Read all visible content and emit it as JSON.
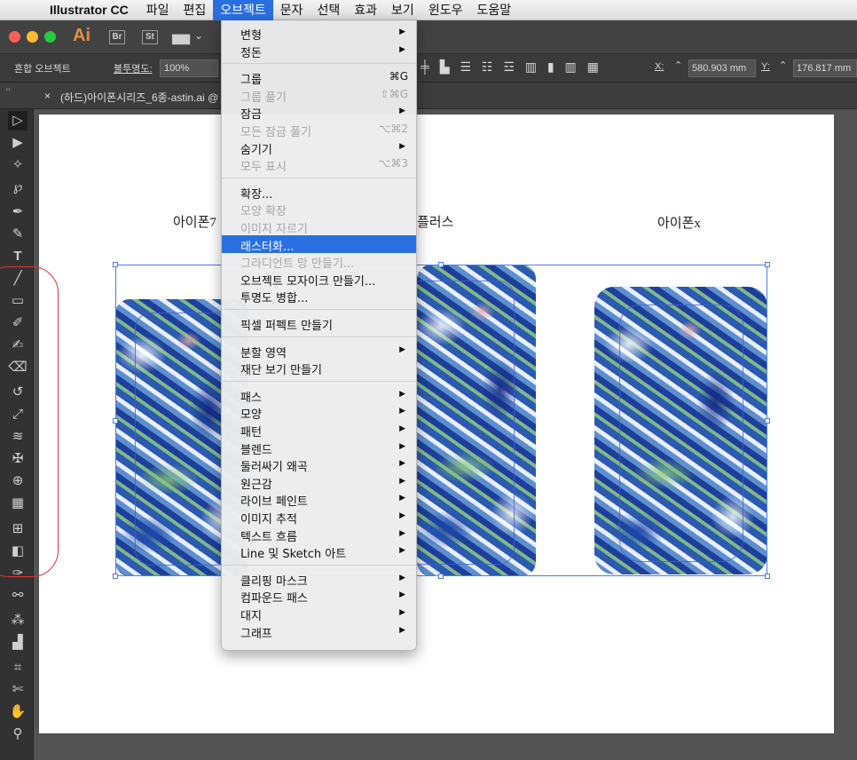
{
  "menubar": {
    "app": "Illustrator CC",
    "items": [
      "파일",
      "편집",
      "오브젝트",
      "문자",
      "선택",
      "효과",
      "보기",
      "윈도우",
      "도움말"
    ],
    "active_index": 2
  },
  "appbar": {
    "logo": "Ai",
    "br": "Br",
    "st": "St"
  },
  "controlbar": {
    "object_type": "혼합 오브젝트",
    "opacity_label": "불투명도:",
    "opacity_value": "100%",
    "x_label": "X:",
    "x_value": "580.903 mm",
    "y_label": "Y:",
    "y_value": "176.817 mm"
  },
  "document_tab": {
    "title": "(하드)아이폰시리즈_6종-astin.ai @"
  },
  "labels": {
    "a": "아이폰7",
    "b": "플러스",
    "c": "아이폰x"
  },
  "menu": {
    "groups": [
      [
        {
          "t": "변형",
          "a": true
        },
        {
          "t": "정돈",
          "a": true
        }
      ],
      [
        {
          "t": "그룹",
          "k": "⌘G"
        },
        {
          "t": "그룹 풀기",
          "k": "⇧⌘G",
          "dis": true
        },
        {
          "t": "잠금",
          "a": true
        },
        {
          "t": "모든 잠금 풀기",
          "k": "⌥⌘2",
          "dis": true
        },
        {
          "t": "숨기기",
          "a": true
        },
        {
          "t": "모두 표시",
          "k": "⌥⌘3",
          "dis": true
        }
      ],
      [
        {
          "t": "확장..."
        },
        {
          "t": "모양 확장",
          "dis": true
        },
        {
          "t": "이미지 자르기",
          "dis": true
        },
        {
          "t": "래스터화...",
          "hi": true
        },
        {
          "t": "그라디언트 망 만들기...",
          "dis": true
        },
        {
          "t": "오브젝트 모자이크 만들기..."
        },
        {
          "t": "투명도 병합..."
        }
      ],
      [
        {
          "t": "픽셀 퍼펙트 만들기"
        }
      ],
      [
        {
          "t": "분할 영역",
          "a": true
        },
        {
          "t": "재단 보기 만들기"
        }
      ],
      [
        {
          "t": "패스",
          "a": true
        },
        {
          "t": "모양",
          "a": true
        },
        {
          "t": "패턴",
          "a": true
        },
        {
          "t": "블렌드",
          "a": true
        },
        {
          "t": "둘러싸기 왜곡",
          "a": true
        },
        {
          "t": "원근감",
          "a": true
        },
        {
          "t": "라이브 페인트",
          "a": true
        },
        {
          "t": "이미지 추적",
          "a": true
        },
        {
          "t": "텍스트 흐름",
          "a": true
        },
        {
          "t": "Line 및 Sketch 아트",
          "a": true
        }
      ],
      [
        {
          "t": "클리핑 마스크",
          "a": true
        },
        {
          "t": "컴파운드 패스",
          "a": true
        },
        {
          "t": "대지",
          "a": true
        },
        {
          "t": "그래프",
          "a": true
        }
      ]
    ]
  }
}
